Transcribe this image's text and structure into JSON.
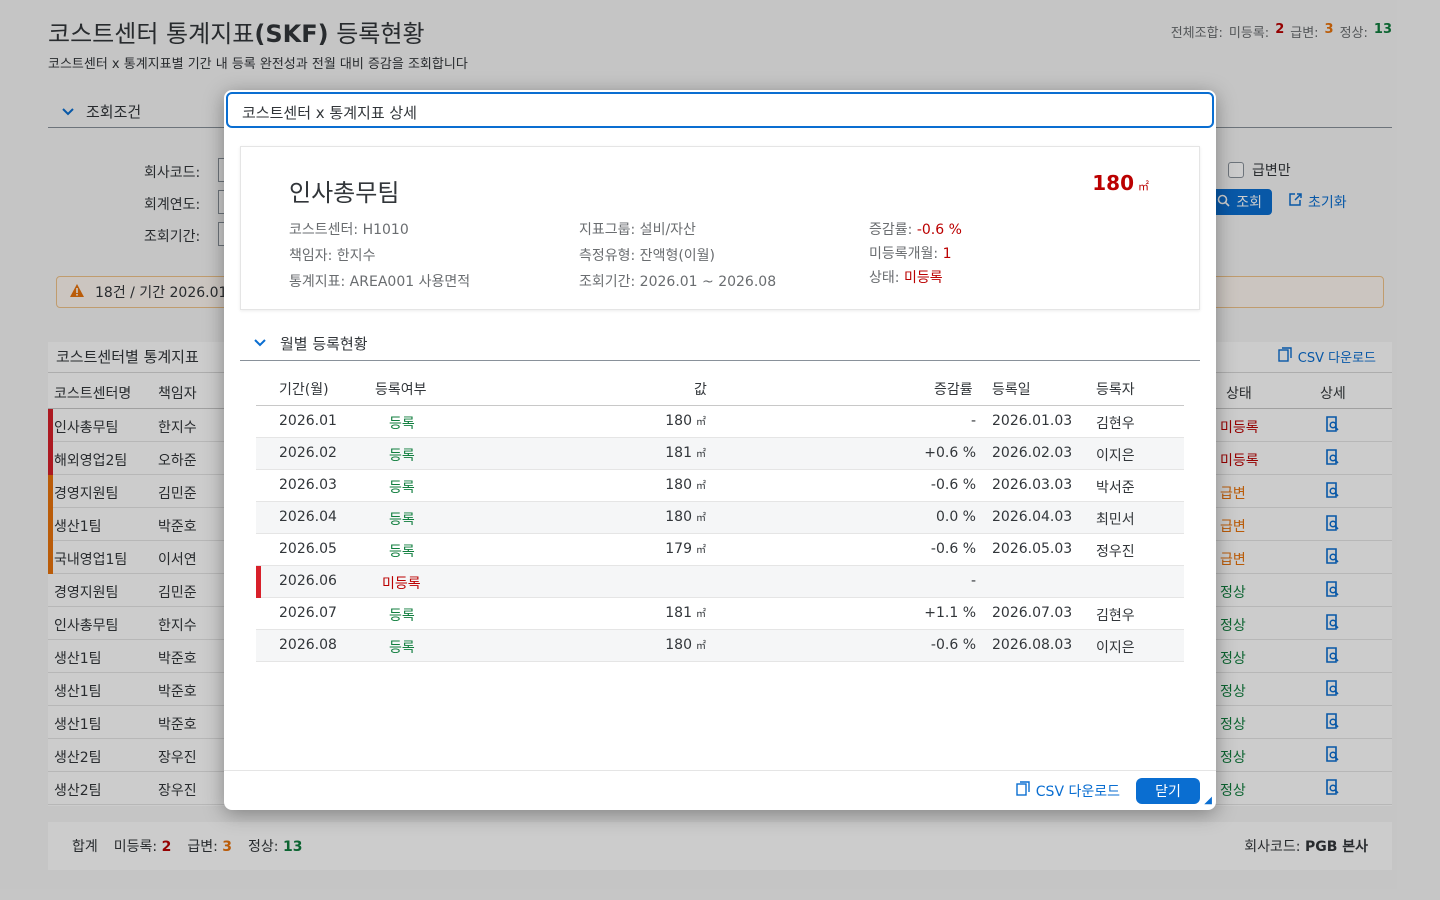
{
  "header": {
    "title_plain": "코스트센터 통계지표",
    "title_bold": "(SKF)",
    "title_tail": " 등록현황",
    "subtitle": "코스트센터 x 통계지표별 기간 내 등록 완전성과 전월 대비 증감을 조회합니다",
    "summary_label": "전체조합:",
    "unreg_label": "미등록:",
    "unreg_count": "2",
    "spike_label": "급변:",
    "spike_count": "3",
    "normal_label": "정상:",
    "normal_count": "13"
  },
  "filter": {
    "section_label": "조회조건",
    "company_label": "회사코드:",
    "year_label": "회계연도:",
    "period_label": "조회기간:",
    "spike_only_label": "급변만",
    "search_label": "조회",
    "reset_label": "초기화"
  },
  "warning": {
    "text": "18건 / 기간 2026.01"
  },
  "table": {
    "title": "코스트센터별 통계지표",
    "csv_label": "CSV 다운로드",
    "headers": {
      "name": "코스트센터명",
      "owner": "책임자",
      "status": "상태",
      "detail": "상세"
    },
    "rows": [
      {
        "name": "인사총무팀",
        "owner": "한지수",
        "status": "미등록",
        "color": "#d8202a"
      },
      {
        "name": "해외영업2팀",
        "owner": "오하준",
        "status": "미등록",
        "color": "#d8202a"
      },
      {
        "name": "경영지원팀",
        "owner": "김민준",
        "status": "급변",
        "color": "#e9730c"
      },
      {
        "name": "생산1팀",
        "owner": "박준호",
        "status": "급변",
        "color": "#e9730c"
      },
      {
        "name": "국내영업1팀",
        "owner": "이서연",
        "status": "급변",
        "color": "#e9730c"
      },
      {
        "name": "경영지원팀",
        "owner": "김민준",
        "status": "정상",
        "color": ""
      },
      {
        "name": "인사총무팀",
        "owner": "한지수",
        "status": "정상",
        "color": ""
      },
      {
        "name": "생산1팀",
        "owner": "박준호",
        "status": "정상",
        "color": ""
      },
      {
        "name": "생산1팀",
        "owner": "박준호",
        "status": "정상",
        "color": ""
      },
      {
        "name": "생산1팀",
        "owner": "박준호",
        "status": "정상",
        "color": ""
      },
      {
        "name": "생산2팀",
        "owner": "장우진",
        "status": "정상",
        "color": ""
      },
      {
        "name": "생산2팀",
        "owner": "장우진",
        "status": "정상",
        "color": ""
      }
    ]
  },
  "footer": {
    "total_label": "합계",
    "unreg_label": "미등록:",
    "unreg_count": "2",
    "spike_label": "급변:",
    "spike_count": "3",
    "normal_label": "정상:",
    "normal_count": "13",
    "company_label": "회사코드:",
    "company_value": "PGB 본사"
  },
  "dialog": {
    "title": "코스트센터 x 통계지표 상세",
    "card": {
      "name": "인사총무팀",
      "value": "180",
      "unit": "㎡",
      "cost_center": "코스트센터: H1010",
      "owner": "책임자: 한지수",
      "indicator": "통계지표: AREA001 사용면적",
      "group": "지표그룹: 설비/자산",
      "measure_type": "측정유형: 잔액형(이월)",
      "period": "조회기간: 2026.01 ~ 2026.08",
      "change_label": "증감률:",
      "change_value": "-0.6 %",
      "unreg_months_label": "미등록개월:",
      "unreg_months_value": "1",
      "status_label": "상태:",
      "status_value": "미등록"
    },
    "section_label": "월별 등록현황",
    "columns": {
      "period": "기간(월)",
      "reg": "등록여부",
      "value": "값",
      "change": "증감률",
      "date": "등록일",
      "user": "등록자"
    },
    "rows": [
      {
        "period": "2026.01",
        "reg": "등록",
        "value": "180",
        "unit": "㎡",
        "change": "-",
        "date": "2026.01.03",
        "user": "김현우"
      },
      {
        "period": "2026.02",
        "reg": "등록",
        "value": "181",
        "unit": "㎡",
        "change": "+0.6 %",
        "date": "2026.02.03",
        "user": "이지은"
      },
      {
        "period": "2026.03",
        "reg": "등록",
        "value": "180",
        "unit": "㎡",
        "change": "-0.6 %",
        "date": "2026.03.03",
        "user": "박서준"
      },
      {
        "period": "2026.04",
        "reg": "등록",
        "value": "180",
        "unit": "㎡",
        "change": "0.0 %",
        "date": "2026.04.03",
        "user": "최민서"
      },
      {
        "period": "2026.05",
        "reg": "등록",
        "value": "179",
        "unit": "㎡",
        "change": "-0.6 %",
        "date": "2026.05.03",
        "user": "정우진"
      },
      {
        "period": "2026.06",
        "reg": "미등록",
        "value": "",
        "unit": "",
        "change": "-",
        "date": "",
        "user": ""
      },
      {
        "period": "2026.07",
        "reg": "등록",
        "value": "181",
        "unit": "㎡",
        "change": "+1.1 %",
        "date": "2026.07.03",
        "user": "김현우"
      },
      {
        "period": "2026.08",
        "reg": "등록",
        "value": "180",
        "unit": "㎡",
        "change": "-0.6 %",
        "date": "2026.08.03",
        "user": "이지은"
      }
    ],
    "csv_label": "CSV 다운로드",
    "close_label": "닫기"
  }
}
